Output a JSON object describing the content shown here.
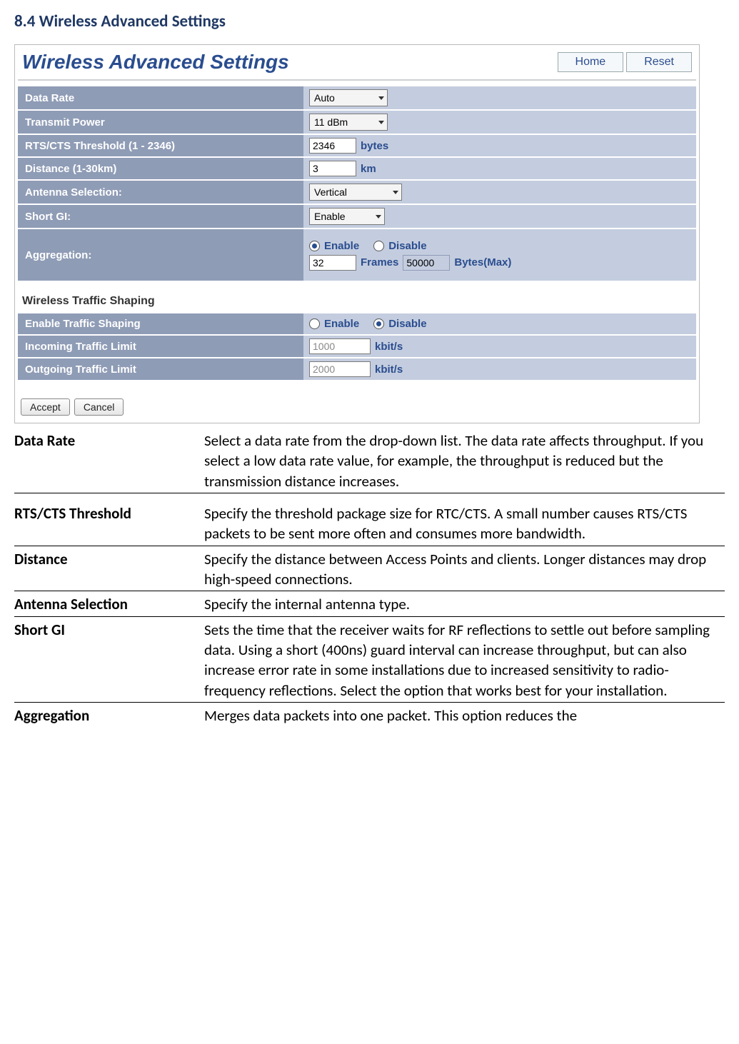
{
  "heading": "8.4 Wireless Advanced Settings",
  "panel": {
    "title": "Wireless Advanced Settings",
    "buttons": {
      "home": "Home",
      "reset": "Reset"
    },
    "rows": {
      "data_rate": {
        "label": "Data Rate",
        "value": "Auto"
      },
      "tx_power": {
        "label": "Transmit Power",
        "value": "11 dBm"
      },
      "rts_cts": {
        "label": "RTS/CTS Threshold (1 - 2346)",
        "value": "2346",
        "unit": "bytes"
      },
      "distance": {
        "label": "Distance (1-30km)",
        "value": "3",
        "unit": "km"
      },
      "antenna": {
        "label": "Antenna Selection:",
        "value": "Vertical"
      },
      "short_gi": {
        "label": "Short GI:",
        "value": "Enable"
      },
      "aggregation": {
        "label": "Aggregation:",
        "enable": "Enable",
        "disable": "Disable",
        "selected": "enable",
        "frames_value": "32",
        "frames_unit": "Frames",
        "bytes_value": "50000",
        "bytes_unit": "Bytes(Max)"
      }
    },
    "traffic": {
      "heading": "Wireless Traffic Shaping",
      "enable_row": {
        "label": "Enable Traffic Shaping",
        "enable": "Enable",
        "disable": "Disable",
        "selected": "disable"
      },
      "incoming": {
        "label": "Incoming Traffic Limit",
        "value": "1000",
        "unit": "kbit/s"
      },
      "outgoing": {
        "label": "Outgoing Traffic Limit",
        "value": "2000",
        "unit": "kbit/s"
      }
    },
    "footer": {
      "accept": "Accept",
      "cancel": "Cancel"
    }
  },
  "descriptions": [
    {
      "term": "Data Rate",
      "text": "Select a data rate from the drop-down list. The data rate affects throughput. If you select a low data rate value, for example, the throughput is reduced but the transmission distance increases."
    },
    {
      "term": "RTS/CTS Threshold",
      "text": "Specify the threshold package size for RTC/CTS. A small number causes RTS/CTS packets to be sent more often and consumes more bandwidth."
    },
    {
      "term": "Distance",
      "text": "Specify the distance between Access Points and clients. Longer distances may drop high-speed connections."
    },
    {
      "term": "Antenna Selection",
      "text": "Specify the internal antenna type."
    },
    {
      "term": "Short GI",
      "text": "Sets the time that the receiver waits for RF reflections to settle out before sampling data. Using a short (400ns) guard interval can increase throughput, but can also increase error rate in some installations due to increased sensitivity to radio-frequency reflections. Select the option that works best for your installation."
    },
    {
      "term": "Aggregation",
      "text": "Merges data packets into one packet. This option reduces the"
    }
  ]
}
